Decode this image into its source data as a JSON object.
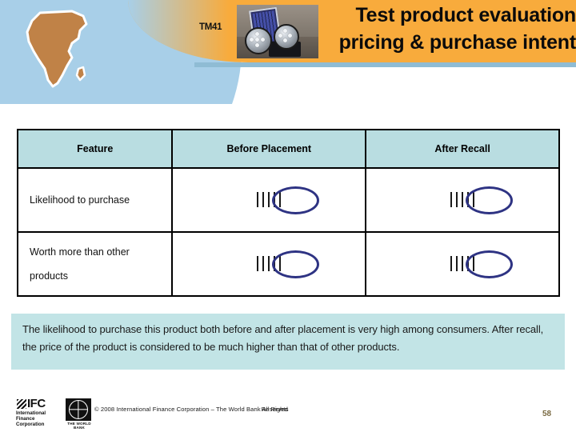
{
  "header": {
    "tm_code": "TM41",
    "title_line1": "Test product evaluation",
    "title_line2": "pricing & purchase intent",
    "africa_map_icon": "africa-map-icon",
    "product_photo_icon": "solar-lamp-product-photo"
  },
  "table": {
    "columns": [
      "Feature",
      "Before Placement",
      "After Recall"
    ],
    "rows": [
      {
        "feature": "Likelihood to purchase",
        "before": {
          "swatches": [
            "#f20d0d",
            "#f98b8b",
            "#f9a51a",
            "#85c285",
            "#0b7d16"
          ],
          "highlighted_index": 4
        },
        "after": {
          "swatches": [
            "#f20d0d",
            "#f98b8b",
            "#f9a51a",
            "#85c285",
            "#0b7d16"
          ],
          "highlighted_index": 4
        }
      },
      {
        "feature": "Worth more than other products",
        "before": {
          "swatches": [
            "#f20d0d",
            "#f98b8b",
            "#f9a51a",
            "#85c285",
            "#0b7d16"
          ],
          "highlighted_index": 4
        },
        "after": {
          "swatches": [
            "#f20d0d",
            "#f98b8b",
            "#f9a51a",
            "#85c285",
            "#0b7d16"
          ],
          "highlighted_index": 4
        }
      }
    ]
  },
  "summary": {
    "text": "The likelihood to purchase this product both before and after placement is very high among consumers. After recall, the price of the product is considered to be much higher than that of other products."
  },
  "footer": {
    "ifc_word": "IFC",
    "ifc_subtitle": "International Finance Corporation",
    "world_bank_label": "THE WORLD BANK",
    "copyright_main": "© 2008 International Finance Corporation – The World Bank All Rights",
    "copyright_overlap": "Reserved",
    "page_number": "58"
  },
  "colors": {
    "header_orange": "#f8ab3c",
    "header_blue": "#a8cfe8",
    "table_header_blue": "#b9dde1",
    "summary_blue": "#c2e4e6",
    "highlight_ellipse": "#2e3383",
    "africa_brown": "#c08247",
    "page_number_color": "#7a6a42"
  }
}
